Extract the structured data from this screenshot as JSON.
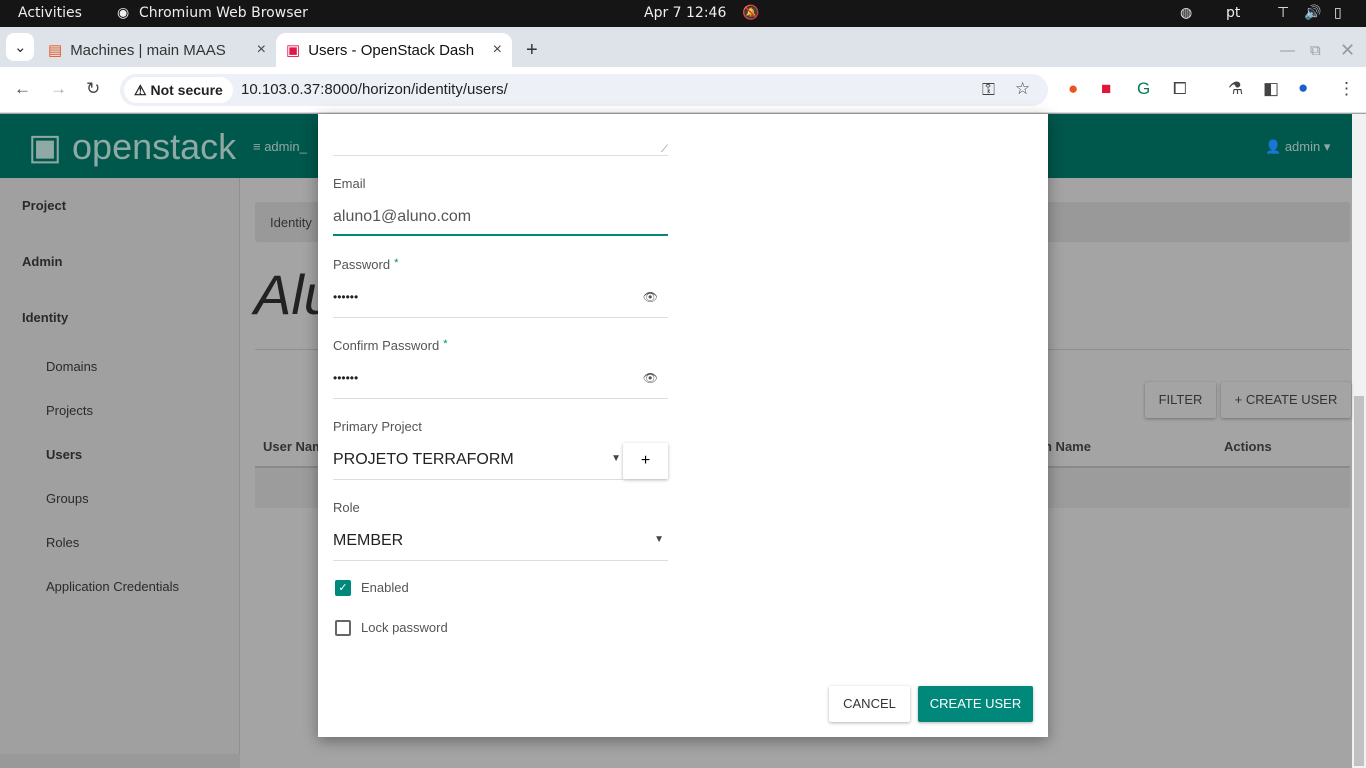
{
  "os": {
    "activities": "Activities",
    "app": "Chromium Web Browser",
    "clock": "Apr 7  12:46",
    "lang": "pt"
  },
  "browser": {
    "tabs": [
      {
        "label": "Machines | main MAAS"
      },
      {
        "label": "Users - OpenStack Dash"
      }
    ],
    "not_secure": "Not secure",
    "url": "10.103.0.37:8000/horizon/identity/users/"
  },
  "header": {
    "logo": "openstack",
    "project": "admin_",
    "user": "admin"
  },
  "sidebar": {
    "items": [
      {
        "label": "Project"
      },
      {
        "label": "Admin"
      },
      {
        "label": "Identity"
      },
      {
        "label": "Domains"
      },
      {
        "label": "Projects"
      },
      {
        "label": "Users"
      },
      {
        "label": "Groups"
      },
      {
        "label": "Roles"
      },
      {
        "label": "Application Credentials"
      }
    ]
  },
  "page": {
    "breadcrumb": "Identity",
    "title": "Alu",
    "filter": "FILTER",
    "create_user": "+ CREATE USER",
    "columns": [
      "User Nam",
      "n Name",
      "Actions"
    ]
  },
  "modal": {
    "email_label": "Email",
    "email_value": "aluno1@aluno.com",
    "password_label": "Password",
    "password_value": "••••••",
    "confirm_label": "Confirm Password",
    "confirm_value": "••••••",
    "required": "*",
    "project_label": "Primary Project",
    "project_value": "PROJETO TERRAFORM",
    "add": "+",
    "role_label": "Role",
    "role_value": "MEMBER",
    "enabled_label": "Enabled",
    "enabled": true,
    "lock_label": "Lock password",
    "lock": false,
    "cancel": "CANCEL",
    "submit": "CREATE USER"
  },
  "colors": {
    "accent": "#00897b",
    "header": "#00574c"
  }
}
